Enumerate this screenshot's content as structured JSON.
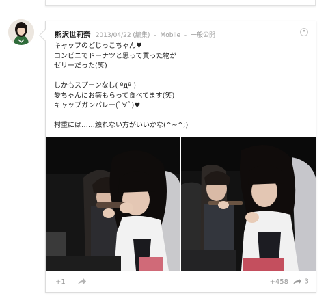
{
  "post": {
    "author": "熊沢世莉奈",
    "date": "2013/04/22 (編集)",
    "source": "Mobile",
    "visibility": "一般公開",
    "lines": [
      "キャップのどじっこちゃん♥",
      "コンビニでドーナツと思って買った物が",
      "ゼリーだった(笑)",
      "",
      "しかもスプーンなし( ºдº )",
      "愛ちゃんにお箸もらって食べてます(笑)",
      "キャップガンバレー(ﾟ∀ﾟ)♥",
      "",
      "村重には……触れない方がいいかな(^~^;)"
    ]
  },
  "footer": {
    "plus_one_label": "+1",
    "plus_count": "+458",
    "share_count": "3"
  },
  "icons": {
    "menu": "chevron-down-icon",
    "share": "share-arrow-icon"
  }
}
